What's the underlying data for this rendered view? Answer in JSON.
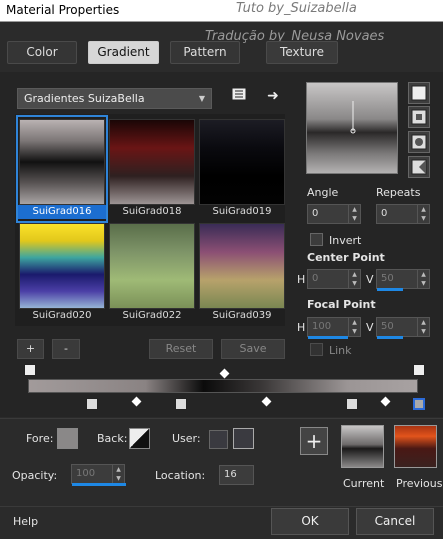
{
  "window": {
    "title": "Material Properties",
    "watermark1": "Tuto by_Suizabella",
    "watermark2": "Tradução by_Neusa Novaes"
  },
  "tabs": [
    {
      "label": "Color"
    },
    {
      "label": "Gradient",
      "active": true
    },
    {
      "label": "Pattern"
    },
    {
      "label": "Texture"
    }
  ],
  "gradient_set": {
    "selected": "Gradientes SuizaBella"
  },
  "gradients": [
    {
      "label": "SuiGrad016",
      "colors": [
        "#b9b2b2",
        "#7c7676",
        "#111",
        "#595454",
        "#a9a4a4"
      ],
      "selected": true
    },
    {
      "label": "SuiGrad018",
      "colors": [
        "#1a0606",
        "#6a1515",
        "#2e2020",
        "#9d9494"
      ]
    },
    {
      "label": "SuiGrad019",
      "colors": [
        "#1c1c24",
        "#0a0a0f",
        "#000",
        "#020202"
      ]
    },
    {
      "label": "SuiGrad020",
      "colors": [
        "#fbe22a",
        "#e2c81b",
        "#3da5a0",
        "#1a1a6c",
        "#4b3fa6",
        "#96b5d6"
      ]
    },
    {
      "label": "SuiGrad022",
      "colors": [
        "#5a6e4a",
        "#7e9468",
        "#9fba76",
        "#7b9158"
      ]
    },
    {
      "label": "SuiGrad039",
      "colors": [
        "#3a2c56",
        "#8b4f74",
        "#b7a26b",
        "#7a8752"
      ]
    }
  ],
  "buttons": {
    "add": "+",
    "remove": "-",
    "reset": "Reset",
    "save": "Save"
  },
  "angle": {
    "label": "Angle",
    "value": "0"
  },
  "repeats": {
    "label": "Repeats",
    "value": "0"
  },
  "invert": {
    "label": "Invert"
  },
  "center_point": {
    "label": "Center Point",
    "h_label": "H",
    "h": "0",
    "v_label": "V",
    "v": "50"
  },
  "focal_point": {
    "label": "Focal Point",
    "h_label": "H",
    "h": "100",
    "v_label": "V",
    "v": "50"
  },
  "link": {
    "label": "Link"
  },
  "fore": {
    "label": "Fore:",
    "color": "#8a8888"
  },
  "back": {
    "label": "Back:"
  },
  "user": {
    "label": "User:"
  },
  "opacity": {
    "label": "Opacity:",
    "value": "100"
  },
  "location": {
    "label": "Location:",
    "value": "16"
  },
  "current": {
    "label": "Current"
  },
  "previous": {
    "label": "Previous"
  },
  "footer": {
    "help": "Help",
    "ok": "OK",
    "cancel": "Cancel"
  }
}
